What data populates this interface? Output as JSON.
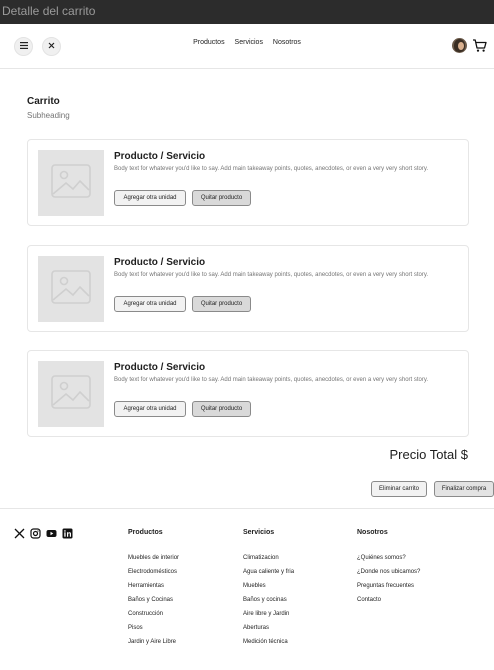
{
  "window": {
    "title": "Detalle del carrito"
  },
  "header": {
    "nav": [
      "Productos",
      "Servicios",
      "Nosotros"
    ],
    "icons": {
      "menu": "menu-icon",
      "close": "close-icon",
      "cart": "cart-icon"
    }
  },
  "page": {
    "title": "Carrito",
    "subheading": "Subheading"
  },
  "items": [
    {
      "title": "Producto / Servicio",
      "body": "Body text for whatever you'd like to say. Add main takeaway points, quotes, anecdotes, or even a very very short story.",
      "add_label": "Agregar otra unidad",
      "remove_label": "Quitar producto"
    },
    {
      "title": "Producto / Servicio",
      "body": "Body text for whatever you'd like to say. Add main takeaway points, quotes, anecdotes, or even a very very short story.",
      "add_label": "Agregar otra unidad",
      "remove_label": "Quitar producto"
    },
    {
      "title": "Producto / Servicio",
      "body": "Body text for whatever you'd like to say. Add main takeaway points, quotes, anecdotes, or even a very very short story.",
      "add_label": "Agregar otra unidad",
      "remove_label": "Quitar producto"
    }
  ],
  "summary": {
    "total_label": "Precio Total $",
    "delete_label": "Eliminar carrito",
    "checkout_label": "Finalizar compra"
  },
  "footer": {
    "social": [
      "x-icon",
      "instagram-icon",
      "youtube-icon",
      "linkedin-icon"
    ],
    "columns": [
      {
        "heading": "Productos",
        "items": [
          "Muebles de interior",
          "Electrodomésticos",
          "Herramientas",
          "Baños y Cocinas",
          "Construcción",
          "Pisos",
          "Jardin y Aire Libre"
        ]
      },
      {
        "heading": "Servicios",
        "items": [
          "Climatizacion",
          "Agua caliente y fria",
          "Muebles",
          "Baños y cocinas",
          "Aire libre y Jardin",
          "Aberturas",
          "Medición técnica"
        ]
      },
      {
        "heading": "Nosotros",
        "items": [
          "¿Quiénes somos?",
          "¿Donde nos ubicamos?",
          "Preguntas frecuentes",
          "Contacto"
        ]
      }
    ]
  },
  "colors": {
    "titlebar": "#2c2c2c",
    "placeholder": "#e3e3e3",
    "border": "#e6e6e6",
    "muted_text": "#757575"
  }
}
